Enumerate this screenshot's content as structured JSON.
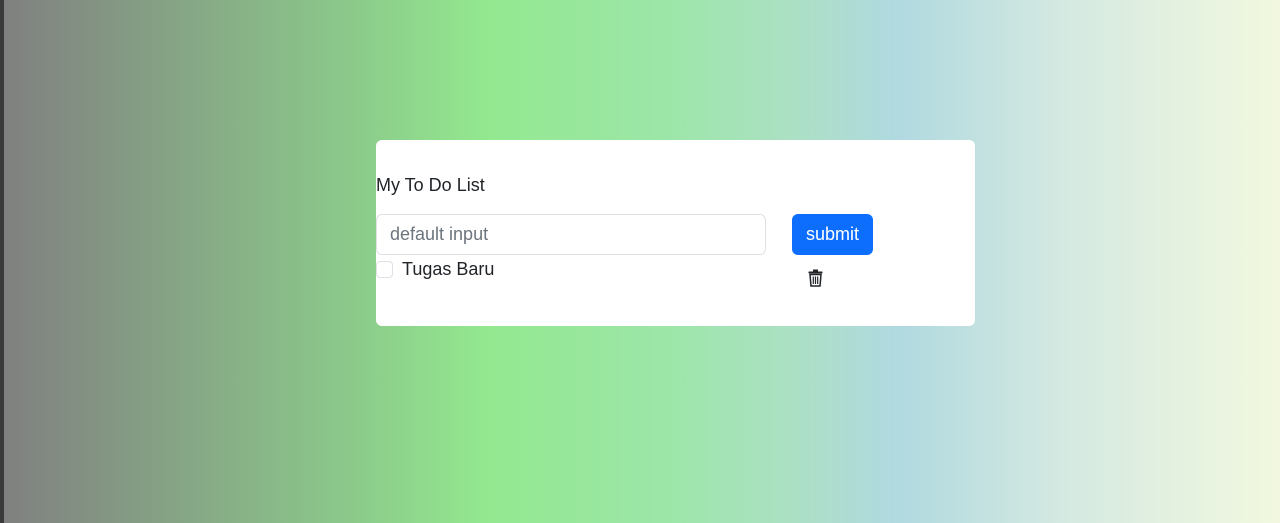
{
  "app": {
    "title": "My To Do List"
  },
  "form": {
    "input_placeholder": "default input",
    "input_value": "",
    "submit_label": "submit"
  },
  "todos": [
    {
      "label": "Tugas Baru",
      "checked": false,
      "delete_icon": "trash-icon"
    }
  ],
  "colors": {
    "button_primary": "#0d6efd",
    "card_background": "#ffffff",
    "text": "#212529"
  }
}
